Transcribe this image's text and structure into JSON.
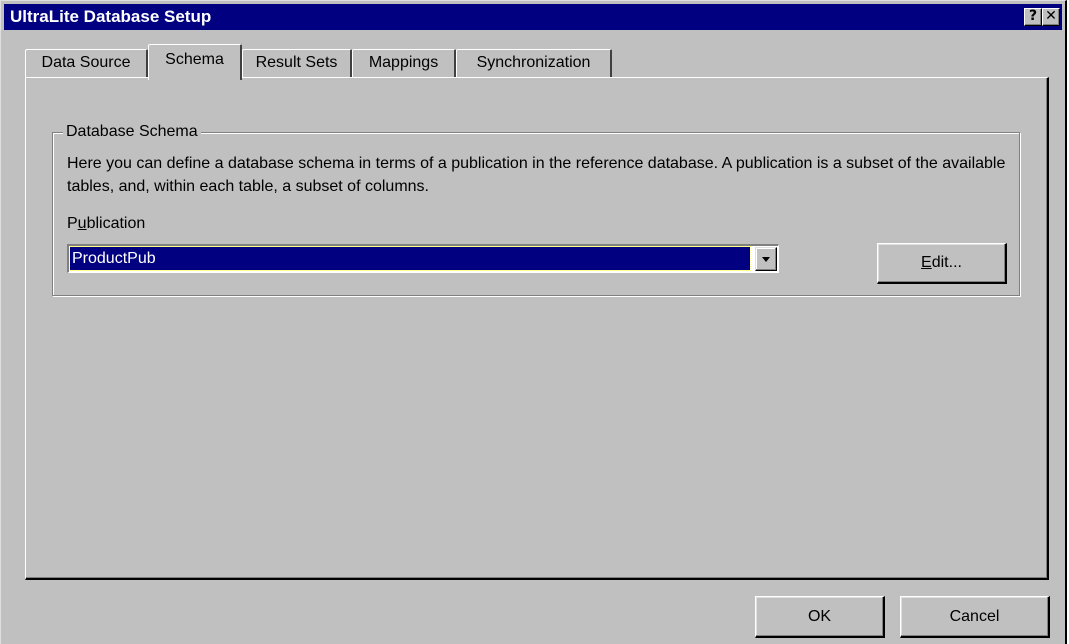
{
  "window": {
    "title": "UltraLite Database Setup",
    "help_glyph": "?",
    "close_glyph": "✕"
  },
  "tabs": [
    {
      "label": "Data Source",
      "active": false
    },
    {
      "label": "Schema",
      "active": true
    },
    {
      "label": "Result Sets",
      "active": false
    },
    {
      "label": "Mappings",
      "active": false
    },
    {
      "label": "Synchronization",
      "active": false
    }
  ],
  "schema": {
    "group_title": "Database Schema",
    "description": "Here you can define a database schema in terms of a publication in the reference database.  A publication is a subset of the available tables, and, within each table, a subset of columns.",
    "publication_label_pre": "P",
    "publication_label_accel": "u",
    "publication_label_post": "blication",
    "publication_value": "ProductPub",
    "edit_accel": "E",
    "edit_rest": "dit..."
  },
  "buttons": {
    "ok": "OK",
    "cancel": "Cancel"
  },
  "colors": {
    "face": "#c0c0c0",
    "titlebar": "#000080",
    "selection": "#000080"
  }
}
